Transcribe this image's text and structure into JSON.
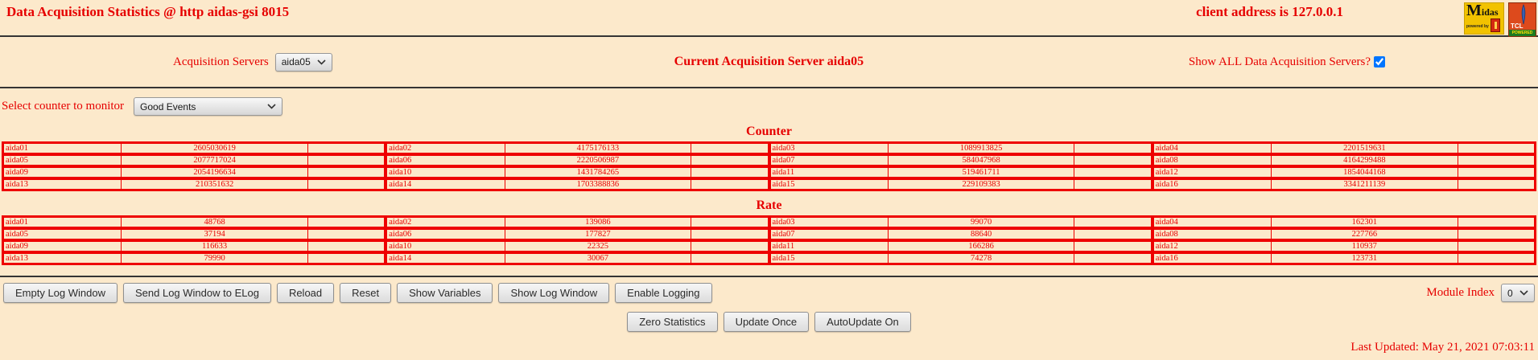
{
  "colors": {
    "background": "#fce9cb",
    "red": "#e60000",
    "table_border": "#ee0000"
  },
  "header": {
    "title": "Data Acquisition Statistics @ http aidas-gsi 8015",
    "client_address": "client address is 127.0.0.1",
    "midas_logo": {
      "text_big": "M",
      "text_rest": "idas",
      "powered_by": "powered by"
    },
    "tcl_logo": {
      "line1": "TCL",
      "line2": "POWERED"
    }
  },
  "server_bar": {
    "label": "Acquisition Servers",
    "selected_server": "aida05",
    "current_server_text": "Current Acquisition Server aida05",
    "show_all_label": "Show ALL Data Acquisition Servers?",
    "show_all_checked": "checked"
  },
  "counter_monitor": {
    "label": "Select counter to monitor",
    "selected": "Good Events"
  },
  "tables": [
    {
      "title": "Counter",
      "entries": [
        {
          "name": "aida01",
          "value": "2605030619"
        },
        {
          "name": "aida02",
          "value": "4175176133"
        },
        {
          "name": "aida03",
          "value": "1089913825"
        },
        {
          "name": "aida04",
          "value": "2201519631"
        },
        {
          "name": "aida05",
          "value": "2077717024"
        },
        {
          "name": "aida06",
          "value": "2220506987"
        },
        {
          "name": "aida07",
          "value": "584047968"
        },
        {
          "name": "aida08",
          "value": "4164299488"
        },
        {
          "name": "aida09",
          "value": "2054196634"
        },
        {
          "name": "aida10",
          "value": "1431784265"
        },
        {
          "name": "aida11",
          "value": "519461711"
        },
        {
          "name": "aida12",
          "value": "1854044168"
        },
        {
          "name": "aida13",
          "value": "210351632"
        },
        {
          "name": "aida14",
          "value": "1703388836"
        },
        {
          "name": "aida15",
          "value": "229109383"
        },
        {
          "name": "aida16",
          "value": "3341211139"
        }
      ]
    },
    {
      "title": "Rate",
      "entries": [
        {
          "name": "aida01",
          "value": "48768"
        },
        {
          "name": "aida02",
          "value": "139086"
        },
        {
          "name": "aida03",
          "value": "99070"
        },
        {
          "name": "aida04",
          "value": "162301"
        },
        {
          "name": "aida05",
          "value": "37194"
        },
        {
          "name": "aida06",
          "value": "177827"
        },
        {
          "name": "aida07",
          "value": "88640"
        },
        {
          "name": "aida08",
          "value": "227766"
        },
        {
          "name": "aida09",
          "value": "116633"
        },
        {
          "name": "aida10",
          "value": "22325"
        },
        {
          "name": "aida11",
          "value": "166286"
        },
        {
          "name": "aida12",
          "value": "110937"
        },
        {
          "name": "aida13",
          "value": "79990"
        },
        {
          "name": "aida14",
          "value": "30067"
        },
        {
          "name": "aida15",
          "value": "74278"
        },
        {
          "name": "aida16",
          "value": "123731"
        }
      ]
    }
  ],
  "toolbar": {
    "buttons": [
      "Empty Log Window",
      "Send Log Window to ELog",
      "Reload",
      "Reset",
      "Show Variables",
      "Show Log Window",
      "Enable Logging"
    ],
    "module_index_label": "Module Index",
    "module_index_value": "0"
  },
  "actions": {
    "buttons": [
      "Zero Statistics",
      "Update Once",
      "AutoUpdate On"
    ]
  },
  "footer": {
    "last_updated": "Last Updated: May 21, 2021 07:03:11"
  }
}
